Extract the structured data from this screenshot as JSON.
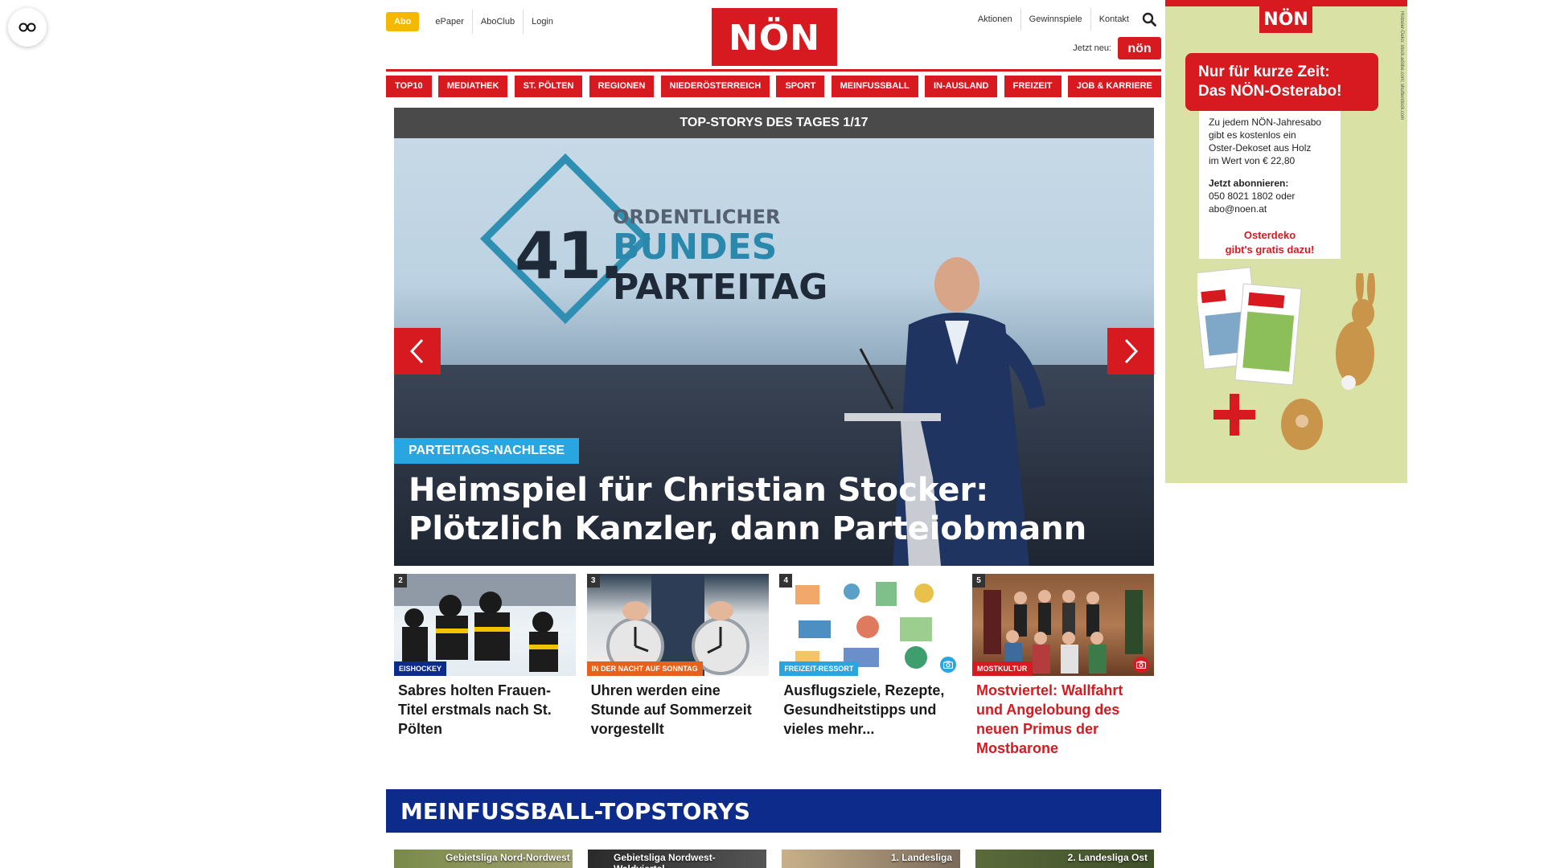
{
  "header": {
    "abo_label": "Abo",
    "top_links": [
      "ePaper",
      "AboClub",
      "Login"
    ],
    "logo_text": "NÖN",
    "right_links": [
      "Aktionen",
      "Gewinnspiele",
      "Kontakt"
    ],
    "jetzt_neu_label": "Jetzt neu:",
    "jetzt_badge_text": "nön",
    "icons": {
      "search": "search-icon",
      "reader": "glasses-icon"
    }
  },
  "nav": {
    "items": [
      "TOP10",
      "MEDIATHEK",
      "ST. PÖLTEN",
      "REGIONEN",
      "NIEDERÖSTERREICH",
      "SPORT",
      "MEINFUSSBALL",
      "IN-AUSLAND",
      "FREIZEIT",
      "JOB & KARRIERE"
    ]
  },
  "hero": {
    "bar_title": "TOP-STORYS DES TAGES 1/17",
    "screen_small": "ORDENTLICHER",
    "screen_num": "41.",
    "screen_mid": "BUNDES",
    "screen_big": "PARTEITAG",
    "tag": "PARTEITAGS-NACHLESE",
    "headline": "Heimspiel für Christian Stocker: Plötzlich Kanzler, dann Parteiobmann",
    "tag_color": "#29a6e0"
  },
  "cards": [
    {
      "num": "2",
      "tag": "EISHOCKEY",
      "tag_color": "#0d2b8a",
      "title": "Sabres holten Frauen-Titel erstmals nach St. Pölten"
    },
    {
      "num": "3",
      "tag": "IN DER NACHT AUF SONNTAG",
      "tag_color": "#e8611a",
      "title": "Uhren werden eine Stunde auf Sommerzeit vorgestellt"
    },
    {
      "num": "4",
      "tag": "FREIZEIT-RESSORT",
      "tag_color": "#29a6e0",
      "title": "Ausflugsziele, Rezepte, Gesundheitstipps und vieles mehr..."
    },
    {
      "num": "5",
      "tag": "MOSTKULTUR",
      "tag_color": "#d71920",
      "title": "Mostviertel: Wallfahrt und Angelobung des neuen Primus der Mostbarone"
    }
  ],
  "meinfussball": {
    "title": "MEINFUSSBALL-TOPSTORYS",
    "thumbs": [
      "Gebietsliga Nord-Nordwest",
      "Gebietsliga Nordwest-Waldviertel",
      "1. Landesliga",
      "2. Landesliga Ost"
    ]
  },
  "ad": {
    "logo": "NÖN",
    "banner_line1": "Nur für kurze Zeit:",
    "banner_line2": "Das NÖN-Osterabo!",
    "body_lines": [
      "Zu jedem NÖN-Jahresabo",
      "gibt es kostenlos ein",
      "Oster-Dekoset aus Holz",
      "im Wert von € 22,80"
    ],
    "cta_title": "Jetzt abonnieren:",
    "cta_lines": [
      "050 8021 1802 oder",
      "abo@noen.at"
    ],
    "red_line1": "Osterdeko",
    "red_line2": "gibt's gratis dazu!",
    "side_text": "Holzeier-Deko: stock.adobe.com; shutterstock.com"
  },
  "colors": {
    "brand_red": "#d71920",
    "navy": "#0d2b8a",
    "abo_yellow": "#f5b800"
  }
}
